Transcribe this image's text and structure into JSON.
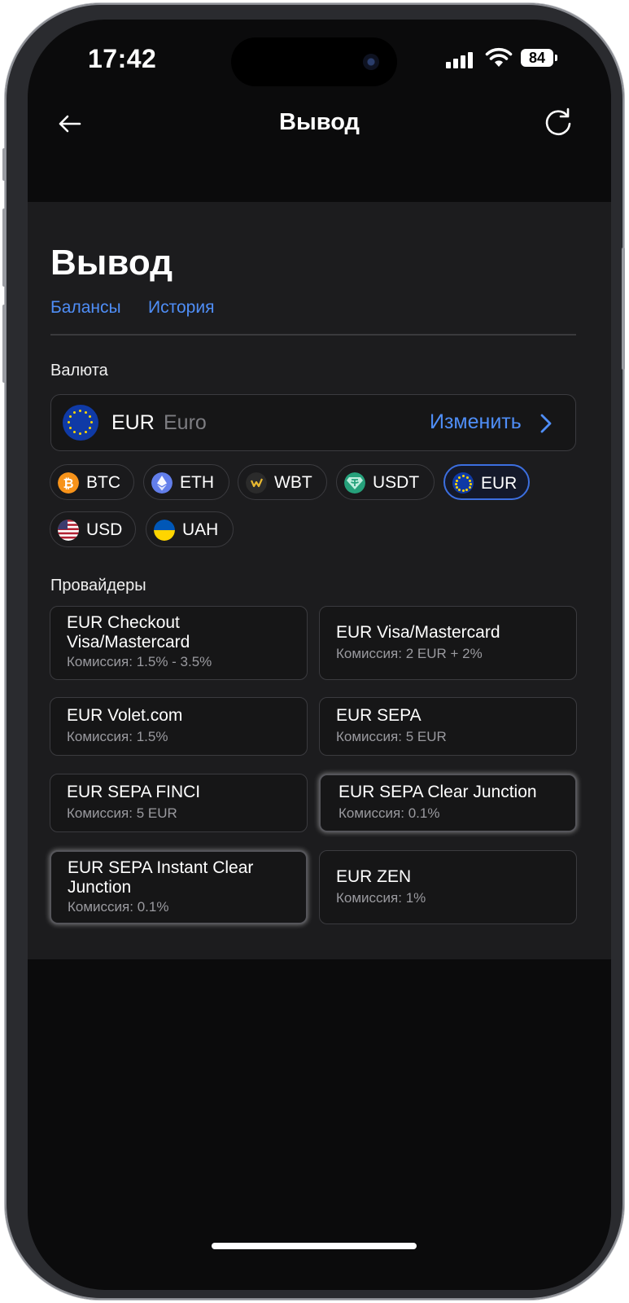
{
  "status_bar": {
    "time": "17:42",
    "battery": "84"
  },
  "navbar": {
    "title": "Вывод"
  },
  "page": {
    "heading": "Вывод",
    "tabs": [
      {
        "label": "Балансы"
      },
      {
        "label": "История"
      }
    ],
    "currency_label": "Валюта",
    "currency_select": {
      "code": "EUR",
      "name": "Euro",
      "change_label": "Изменить"
    },
    "currency_chips": [
      {
        "label": "BTC",
        "icon": "bitcoin-icon",
        "color": "#f7931a"
      },
      {
        "label": "ETH",
        "icon": "ethereum-icon",
        "color": "#627eea"
      },
      {
        "label": "WBT",
        "icon": "whitebit-icon",
        "color": "#2b2b2b"
      },
      {
        "label": "USDT",
        "icon": "tether-icon",
        "color": "#26a17b"
      },
      {
        "label": "EUR",
        "icon": "eu-flag-icon",
        "color": "#0f3aa6",
        "selected": true
      },
      {
        "label": "USD",
        "icon": "us-flag-icon",
        "color": "#b22234"
      },
      {
        "label": "UAH",
        "icon": "ukraine-flag-icon",
        "color": "#ffd500"
      }
    ],
    "providers_label": "Провайдеры",
    "providers": [
      {
        "title_lines": [
          "EUR Checkout",
          "Visa/Mastercard"
        ],
        "fee": "Комиссия: 1.5% - 3.5%"
      },
      {
        "title_lines": [
          "EUR Visa/Mastercard"
        ],
        "fee": "Комиссия: 2 EUR + 2%"
      },
      {
        "title_lines": [
          "EUR Volet.com"
        ],
        "fee": "Комиссия: 1.5%"
      },
      {
        "title_lines": [
          "EUR SEPA"
        ],
        "fee": "Комиссия: 5 EUR"
      },
      {
        "title_lines": [
          "EUR SEPA FINCI"
        ],
        "fee": "Комиссия: 5 EUR"
      },
      {
        "title_lines": [
          "EUR SEPA Clear Junction"
        ],
        "fee": "Комиссия: 0.1%"
      },
      {
        "title_lines": [
          "EUR SEPA Instant Clear",
          "Junction"
        ],
        "fee": "Комиссия: 0.1%"
      },
      {
        "title_lines": [
          "EUR ZEN"
        ],
        "fee": "Комиссия: 1%"
      }
    ]
  },
  "colors": {
    "accent": "#4f8ef7",
    "background": "#0b0b0c",
    "panel": "#1c1c1e"
  }
}
